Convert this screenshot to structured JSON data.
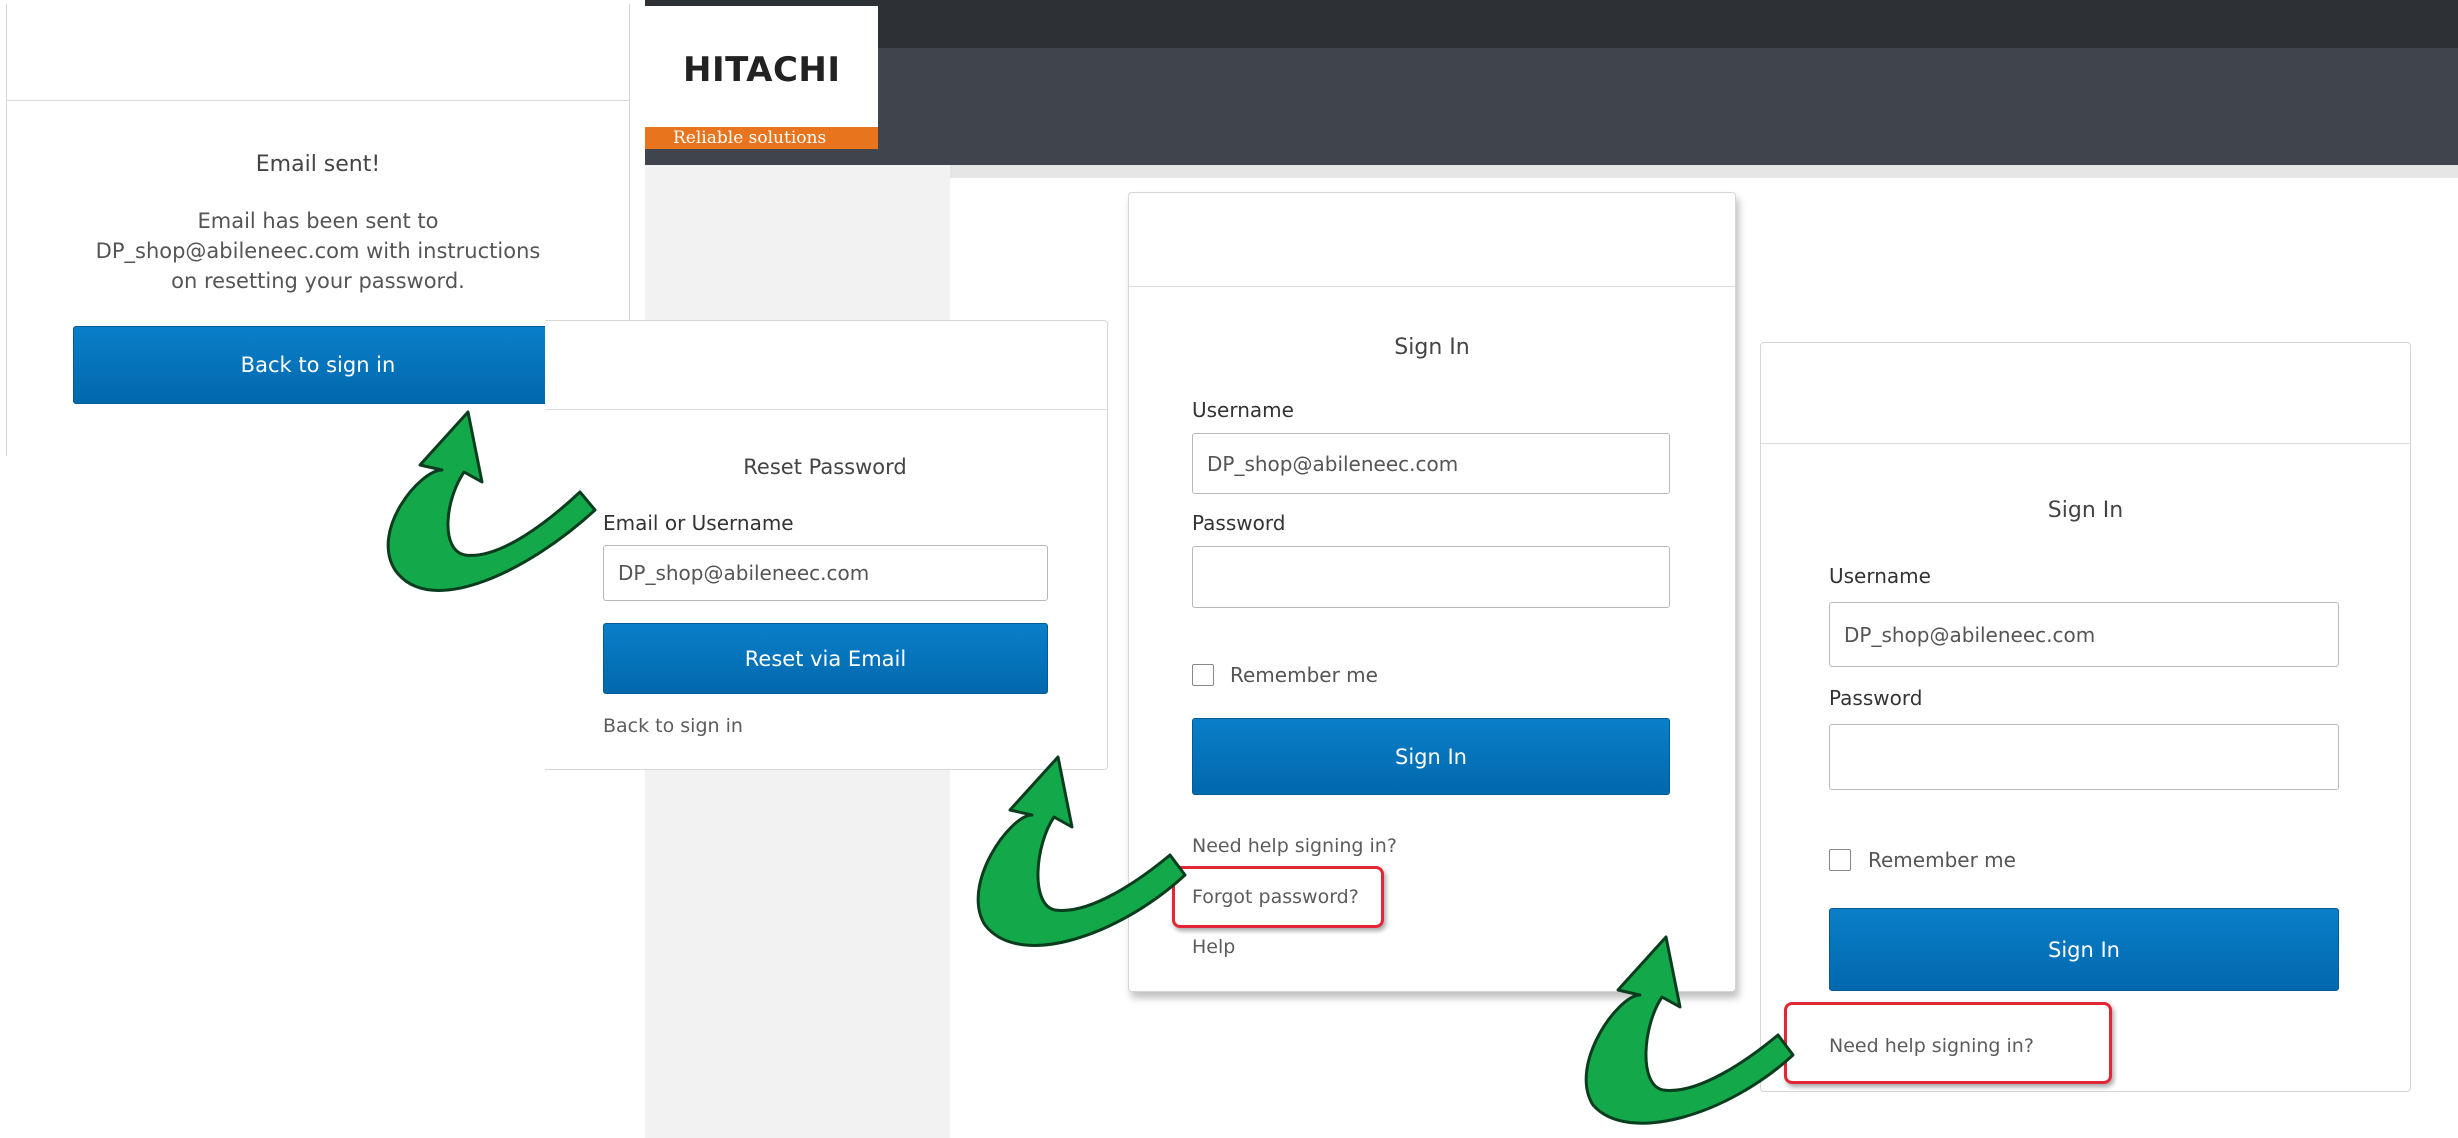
{
  "logo": {
    "brand": "HITACHI",
    "tagline": "Reliable solutions"
  },
  "email_sent_card": {
    "title": "Email sent!",
    "message_line1": "Email has been sent to",
    "message_line2": "DP_shop@abileneec.com with instructions",
    "message_line3": "on resetting your password.",
    "back_button": "Back to sign in"
  },
  "reset_card": {
    "title": "Reset Password",
    "field_label": "Email or Username",
    "field_value": "DP_shop@abileneec.com",
    "reset_button": "Reset via Email",
    "back_link": "Back to sign in"
  },
  "signin_card_middle": {
    "title": "Sign In",
    "username_label": "Username",
    "username_value": "DP_shop@abileneec.com",
    "password_label": "Password",
    "remember_label": "Remember me",
    "signin_button": "Sign In",
    "help_link": "Need help signing in?",
    "forgot_link": "Forgot password?",
    "help2_link": "Help"
  },
  "signin_card_right": {
    "title": "Sign In",
    "username_label": "Username",
    "username_value": "DP_shop@abileneec.com",
    "password_label": "Password",
    "remember_label": "Remember me",
    "signin_button": "Sign In",
    "help_link": "Need help signing in?"
  },
  "colors": {
    "button_blue": "#0073bb",
    "highlight_red": "#e32636",
    "arrow_green": "#13a84a",
    "logo_orange": "#e8741e"
  }
}
